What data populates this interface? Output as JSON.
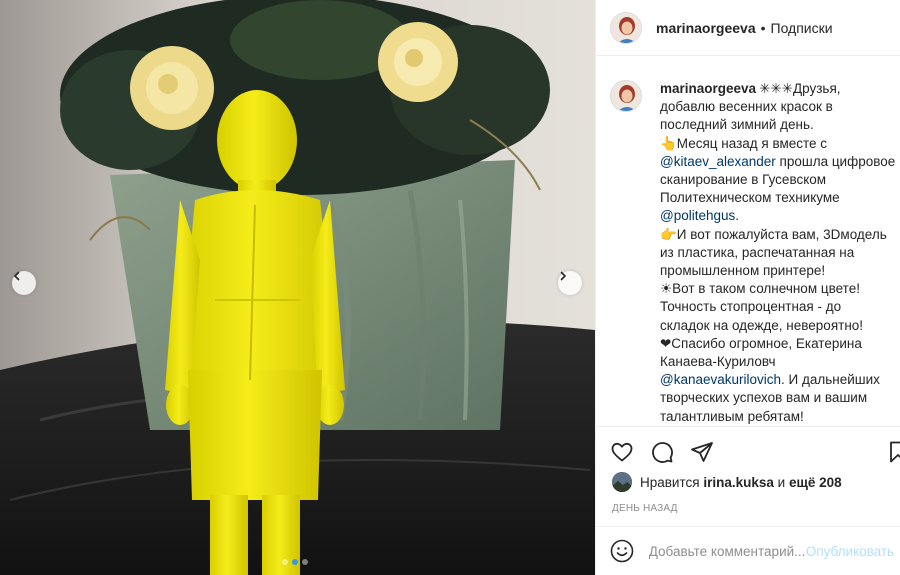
{
  "post": {
    "username": "marinaorgeeva",
    "separator": "•",
    "follow_status": "Подписки"
  },
  "media": {
    "slide_count": 3,
    "active_slide": 2,
    "description_icons": [
      "chevron-left-icon",
      "chevron-right-icon"
    ]
  },
  "caption": {
    "username": "marinaorgeeva",
    "lines": [
      {
        "text": "✳✳✳Друзья,"
      },
      {
        "text": "добавлю весенних красок в"
      },
      {
        "text": "последний зимний день."
      },
      {
        "text": "👆Месяц назад я вместе с"
      },
      {
        "mention": "@kitaev_alexander",
        "text": " прошла цифровое"
      },
      {
        "text": "сканирование в Гусевском"
      },
      {
        "text": "Политехническом техникуме"
      },
      {
        "mention": "@politehgus",
        "text": "."
      },
      {
        "text": "👉И вот пожалуйста вам, 3Dмодель"
      },
      {
        "text": "из пластика, распечатанная на"
      },
      {
        "text": "промышленном принтере!"
      },
      {
        "text": "☀Вот в таком солнечном цвете!"
      },
      {
        "text": "Точность стопроцентная - до"
      },
      {
        "text": "складок на одежде, невероятно!"
      },
      {
        "text": "❤Спасибо огромное, Екатерина"
      },
      {
        "text": "Канаева-Куриловч"
      },
      {
        "mention": "@kanaevakurilovich",
        "text": ". И дальнейших"
      },
      {
        "text": "творческих успехов вам и вашим"
      },
      {
        "text": "талантливым ребятам!"
      }
    ]
  },
  "actions": {
    "icons": [
      "heart-icon",
      "comment-icon",
      "share-icon",
      "bookmark-icon"
    ]
  },
  "likes": {
    "prefix": "Нравится",
    "user": "irina.kuksa",
    "middle": "и",
    "count_text": "ещё 208"
  },
  "timestamp": "ДЕНЬ НАЗАД",
  "comment": {
    "placeholder": "Добавьте комментарий...",
    "publish_label": "Опубликовать"
  },
  "colors": {
    "accent": "#3897f0",
    "mention": "#00376b",
    "muted": "#8e8e8e",
    "publish_disabled": "#b2dffc"
  }
}
